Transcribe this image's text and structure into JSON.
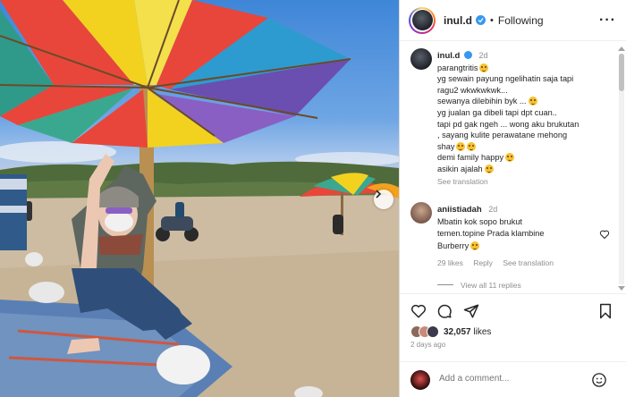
{
  "post": {
    "username": "inul.d",
    "follow_status": "Following",
    "separator": "•",
    "more_icon": "more-horizontal-icon"
  },
  "caption": {
    "username": "inul.d",
    "time": "2d",
    "lines": [
      "parangtritis",
      "yg sewain payung ngelihatin saja tapi",
      "ragu2 wkwkwkwk...",
      "sewanya dilebihin byk ...",
      "yg jualan ga dibeli tapi dpt cuan..",
      "tapi pd gak ngeh ... wong aku brukutan",
      ", sayang kulite perawatane mehong",
      "shay",
      "demi family happy",
      "asikin ajalah"
    ],
    "see_translation": "See translation"
  },
  "comment": {
    "username": "aniistiadah",
    "time": "2d",
    "lines": [
      "Mbatin kok sopo brukut",
      "temen.topine Prada klambine",
      "Burberry"
    ],
    "likes": "29 likes",
    "reply": "Reply",
    "see_translation": "See translation",
    "view_replies": "View all 11 replies"
  },
  "likes": {
    "count": "32,057",
    "suffix": "likes",
    "posted": "2 days ago"
  },
  "add_comment": {
    "placeholder": "Add a comment..."
  },
  "colors": {
    "verified": "#3897f0",
    "muted": "#8e8e8e",
    "text": "#262626"
  }
}
